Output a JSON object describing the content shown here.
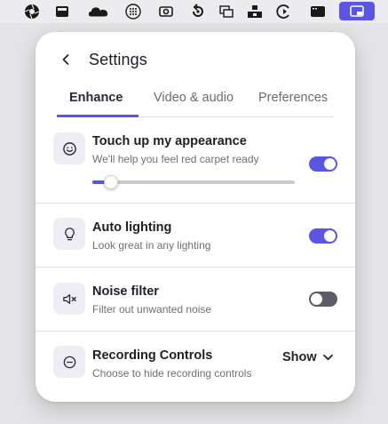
{
  "menubar": {
    "icons": [
      "aperture-icon",
      "screen-icon",
      "cloud-icon",
      "grid-dots-icon",
      "camera-icon",
      "replay-icon",
      "window-icon",
      "stack-icon",
      "record-icon",
      "dark-screen-icon",
      "app-window-icon"
    ]
  },
  "header": {
    "title": "Settings"
  },
  "tabs": [
    {
      "label": "Enhance",
      "active": true
    },
    {
      "label": "Video & audio",
      "active": false
    },
    {
      "label": "Preferences",
      "active": false
    }
  ],
  "settings": {
    "touch_up": {
      "icon": "smile-icon",
      "title": "Touch up my appearance",
      "subtitle": "We'll help you feel red carpet ready",
      "enabled": true,
      "level": 0.09
    },
    "auto_lighting": {
      "icon": "lightbulb-icon",
      "title": "Auto lighting",
      "subtitle": "Look great in any lighting",
      "enabled": true
    },
    "noise_filter": {
      "icon": "speaker-mute-icon",
      "title": "Noise filter",
      "subtitle": "Filter out unwanted noise",
      "enabled": false
    },
    "recording_controls": {
      "icon": "minus-circle-icon",
      "title": "Recording Controls",
      "subtitle": "Choose to hide recording controls",
      "value": "Show"
    }
  },
  "colors": {
    "accent": "#5b55e6",
    "toggle_off": "#5c5c66",
    "icon_bg": "#eeedf6"
  }
}
